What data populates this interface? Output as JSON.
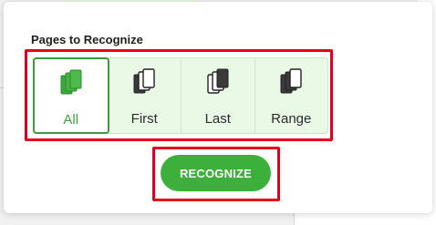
{
  "dialog": {
    "section_title": "Pages to Recognize",
    "options": [
      {
        "id": "all",
        "label": "All",
        "icon": "pages-stack-filled-icon",
        "selected": true
      },
      {
        "id": "first",
        "label": "First",
        "icon": "pages-stack-first-icon",
        "selected": false
      },
      {
        "id": "last",
        "label": "Last",
        "icon": "pages-stack-last-icon",
        "selected": false
      },
      {
        "id": "range",
        "label": "Range",
        "icon": "pages-stack-range-icon",
        "selected": false
      }
    ],
    "recognize_label": "RECOGNIZE"
  },
  "colors": {
    "accent_green": "#3db03b",
    "selected_text": "#3aa43f",
    "highlight_red": "#e4001b",
    "option_bg": "#eaf8e6"
  }
}
